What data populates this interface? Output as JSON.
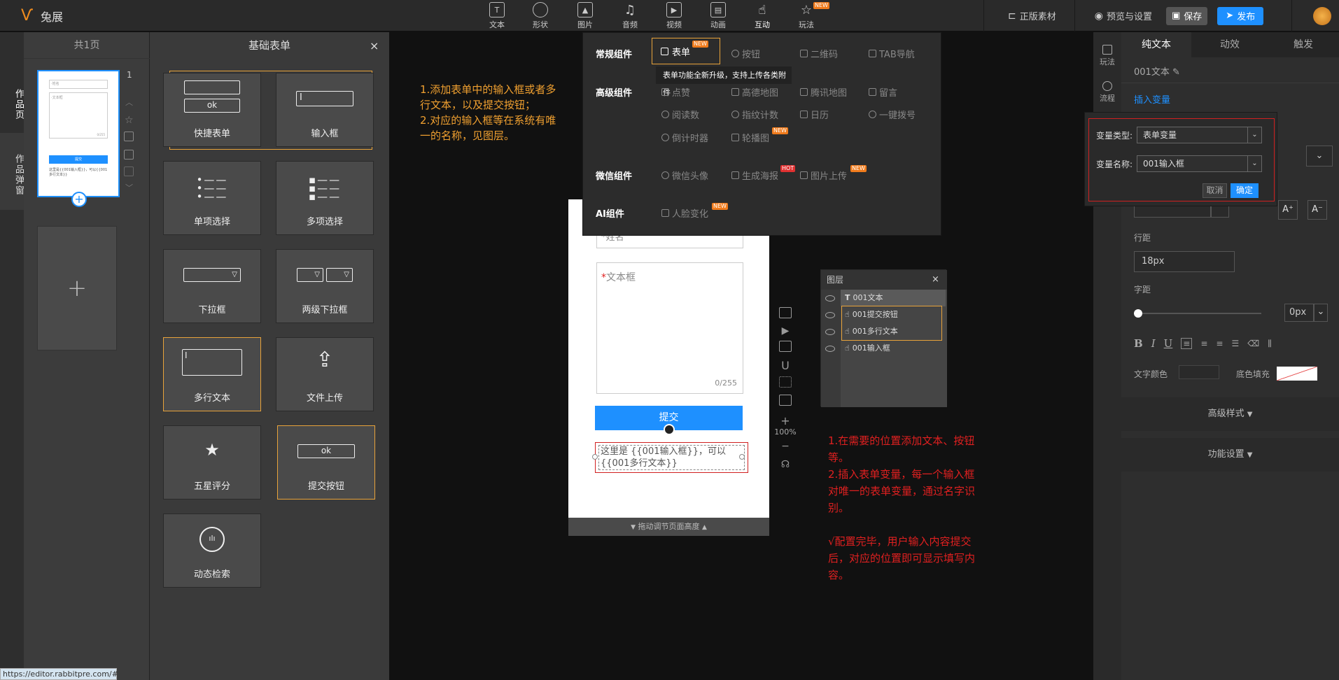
{
  "app": {
    "name": "兔展"
  },
  "toolbar": {
    "items": [
      {
        "label": "文本",
        "icon": "text-icon"
      },
      {
        "label": "形状",
        "icon": "shape-icon"
      },
      {
        "label": "图片",
        "icon": "image-icon"
      },
      {
        "label": "音频",
        "icon": "music-icon"
      },
      {
        "label": "视频",
        "icon": "video-icon"
      },
      {
        "label": "动画",
        "icon": "animation-icon"
      },
      {
        "label": "互动",
        "icon": "hand-pointer-icon"
      },
      {
        "label": "玩法",
        "icon": "star-icon",
        "badge": "NEW"
      }
    ],
    "genuine_assets": "正版素材",
    "preview_settings": "预览与设置",
    "save": "保存",
    "publish": "发布"
  },
  "left_strip": {
    "tab1": "作品页",
    "tab2": "作品弹窗"
  },
  "pages": {
    "header": "共1页",
    "page_number": "1",
    "thumb": {
      "field1": "·姓名",
      "field2": "·文本框",
      "count": "0/255",
      "button": "提交",
      "text": "这里是{{001输入框}}，可以{{001多行文本}}"
    },
    "add_page": "+"
  },
  "form_panel": {
    "title": "基础表单",
    "close": "×",
    "items": [
      {
        "label": "快捷表单",
        "ok": "ok"
      },
      {
        "label": "输入框"
      },
      {
        "label": "单项选择"
      },
      {
        "label": "多项选择"
      },
      {
        "label": "下拉框"
      },
      {
        "label": "两级下拉框"
      },
      {
        "label": "多行文本"
      },
      {
        "label": "文件上传"
      },
      {
        "label": "五星评分"
      },
      {
        "label": "提交按钮",
        "ok": "ok"
      },
      {
        "label": "动态检索"
      }
    ]
  },
  "note_left": "1.添加表单中的输入框或者多行文本，以及提交按钮；\n2.对应的输入框等在系统有唯一的名称，见图层。",
  "component_menu": {
    "rows": [
      "常规组件",
      "高级组件",
      "微信组件",
      "AI组件"
    ],
    "regular": [
      {
        "label": "表单",
        "badge": "NEW"
      },
      {
        "label": "按钮"
      },
      {
        "label": "二维码"
      },
      {
        "label": "TAB导航"
      }
    ],
    "tooltip": "表单功能全新升级，支持上传各类附件",
    "advanced": [
      {
        "label": "点赞"
      },
      {
        "label": "高德地图"
      },
      {
        "label": "腾讯地图"
      },
      {
        "label": "留言"
      },
      {
        "label": "阅读数"
      },
      {
        "label": "指纹计数"
      },
      {
        "label": "日历"
      },
      {
        "label": "一键拨号"
      },
      {
        "label": "倒计时器"
      },
      {
        "label": "轮播图",
        "badge": "NEW"
      }
    ],
    "wechat": [
      {
        "label": "微信头像"
      },
      {
        "label": "生成海报",
        "badge": "HOT"
      },
      {
        "label": "图片上传",
        "badge": "NEW"
      }
    ],
    "ai": [
      {
        "label": "人脸变化",
        "badge": "NEW"
      }
    ]
  },
  "phone": {
    "name_placeholder": "*姓名",
    "textarea_label": "文本框",
    "textarea_count": "0/255",
    "submit": "提交",
    "var_text": "这里是 {{001输入框}}，可以{{001多行文本}}",
    "footer": "拖动调节页面高度"
  },
  "canvas_tools": {
    "zoom": "100%",
    "plus": "+",
    "minus": "−"
  },
  "layers": {
    "title": "图层",
    "close": "×",
    "items": [
      "001文本",
      "001提交按钮",
      "001多行文本",
      "001输入框"
    ]
  },
  "note_right": "1.在需要的位置添加文本、按钮等。\n2.插入表单变量，每一个输入框对唯一的表单变量，通过名字识别。\n\n√配置完毕，用户输入内容提交后，对应的位置即可显示填写内容。",
  "right_icons": [
    {
      "label": "玩法"
    },
    {
      "label": "流程"
    }
  ],
  "right_panel": {
    "tabs": [
      "纯文本",
      "动效",
      "触发"
    ],
    "layer_name": "001文本",
    "insert_var": "插入变量",
    "line_height_label": "行距",
    "line_height_value": "18px",
    "letter_spacing_label": "字距",
    "letter_spacing_value": "0px",
    "text_color_label": "文字颜色",
    "bg_fill_label": "底色填充",
    "advanced_style": "高级样式",
    "func_settings": "功能设置"
  },
  "var_popup": {
    "type_label": "变量类型:",
    "type_value": "表单变量",
    "name_label": "变量名称:",
    "name_value": "001输入框",
    "cancel": "取消",
    "ok": "确定"
  },
  "status_url": "https://editor.rabbitpre.com/#",
  "colors": {
    "accent": "#1e90ff",
    "highlight": "#e8a33a",
    "note_orange": "#f0a030",
    "note_red": "#e02020"
  }
}
